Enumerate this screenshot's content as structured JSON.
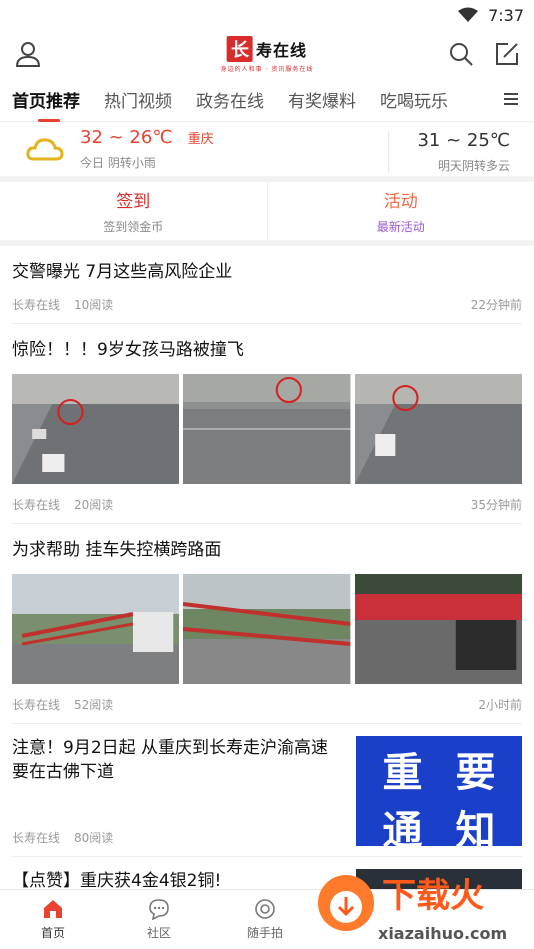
{
  "status": {
    "time": "7:37"
  },
  "header": {
    "logo_mark": "长",
    "logo_text": "寿在线",
    "logo_sub": "身边的人和事 · 资讯服务在线"
  },
  "tabs": [
    "首页推荐",
    "热门视频",
    "政务在线",
    "有奖爆料",
    "吃喝玩乐"
  ],
  "weather": {
    "today": {
      "temp": "32 ~ 26℃",
      "city": "重庆",
      "desc": "今日 阴转小雨"
    },
    "tomorrow": {
      "temp": "31 ~ 25℃",
      "desc": "明天阴转多云"
    }
  },
  "quick": [
    {
      "title": "签到",
      "sub": "签到领金币"
    },
    {
      "title": "活动",
      "sub": "最新活动"
    }
  ],
  "articles": [
    {
      "title": "交警曝光 7月这些高风险企业",
      "source": "长寿在线",
      "reads": "10阅读",
      "time": "22分钟前"
    },
    {
      "title": "惊险！！！9岁女孩马路被撞飞",
      "source": "长寿在线",
      "reads": "20阅读",
      "time": "35分钟前"
    },
    {
      "title": "为求帮助 挂车失控横跨路面",
      "source": "长寿在线",
      "reads": "52阅读",
      "time": "2小时前"
    },
    {
      "title": "注意！9月2日起 从重庆到长寿走沪渝高速要在古佛下道",
      "source": "长寿在线",
      "reads": "80阅读",
      "time": ""
    },
    {
      "title": "【点赞】重庆获4金4银2铜!",
      "source": "",
      "reads": "",
      "time": ""
    }
  ],
  "notice_image": {
    "chars": [
      "重",
      "要",
      "通",
      "知"
    ]
  },
  "bottom_nav": [
    {
      "label": "首页"
    },
    {
      "label": "社区"
    },
    {
      "label": "随手拍"
    }
  ],
  "watermark": {
    "big": "下载火",
    "small": "xiazaihuo.com"
  },
  "colors": {
    "accent": "#e8432f",
    "brand": "#d92b2b",
    "notice_bg": "#1a3fc8"
  }
}
